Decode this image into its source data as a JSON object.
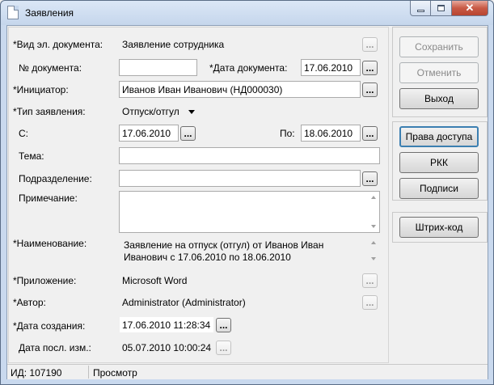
{
  "window": {
    "title": "Заявления"
  },
  "form": {
    "doc_type": {
      "label": "*Вид эл. документа:",
      "value": "Заявление сотрудника"
    },
    "doc_number": {
      "label": "№ документа:",
      "value": ""
    },
    "doc_date": {
      "label": "*Дата документа:",
      "value": "17.06.2010"
    },
    "initiator": {
      "label": "*Инициатор:",
      "value": "Иванов Иван Иванович (НД000030)"
    },
    "request_type": {
      "label": "*Тип заявления:",
      "value": "Отпуск/отгул"
    },
    "from": {
      "label": "С:",
      "value": "17.06.2010"
    },
    "to": {
      "label": "По:",
      "value": "18.06.2010"
    },
    "subject": {
      "label": "Тема:",
      "value": ""
    },
    "department": {
      "label": "Подразделение:",
      "value": ""
    },
    "note": {
      "label": "Примечание:",
      "value": ""
    },
    "name": {
      "label": "*Наименование:",
      "value": "Заявление на отпуск (отгул) от Иванов Иван Иванович с 17.06.2010 по 18.06.2010"
    },
    "attachment": {
      "label": "*Приложение:",
      "value": "Microsoft Word"
    },
    "author": {
      "label": "*Автор:",
      "value": "Administrator (Administrator)"
    },
    "created": {
      "label": "*Дата создания:",
      "value": "17.06.2010 11:28:34"
    },
    "modified": {
      "label": "Дата посл. изм.:",
      "value": "05.07.2010 10:00:24"
    },
    "ellipsis": "..."
  },
  "buttons": {
    "save": "Сохранить",
    "cancel": "Отменить",
    "exit": "Выход",
    "access_rights": "Права доступа",
    "rkk": "РКК",
    "signatures": "Подписи",
    "barcode": "Штрих-код"
  },
  "status": {
    "id": "ИД: 107190",
    "mode": "Просмотр"
  },
  "colors": {
    "window_frame": "#c9d9ee",
    "close_button": "#c85a45",
    "default_button_border": "#3c7fb1"
  }
}
